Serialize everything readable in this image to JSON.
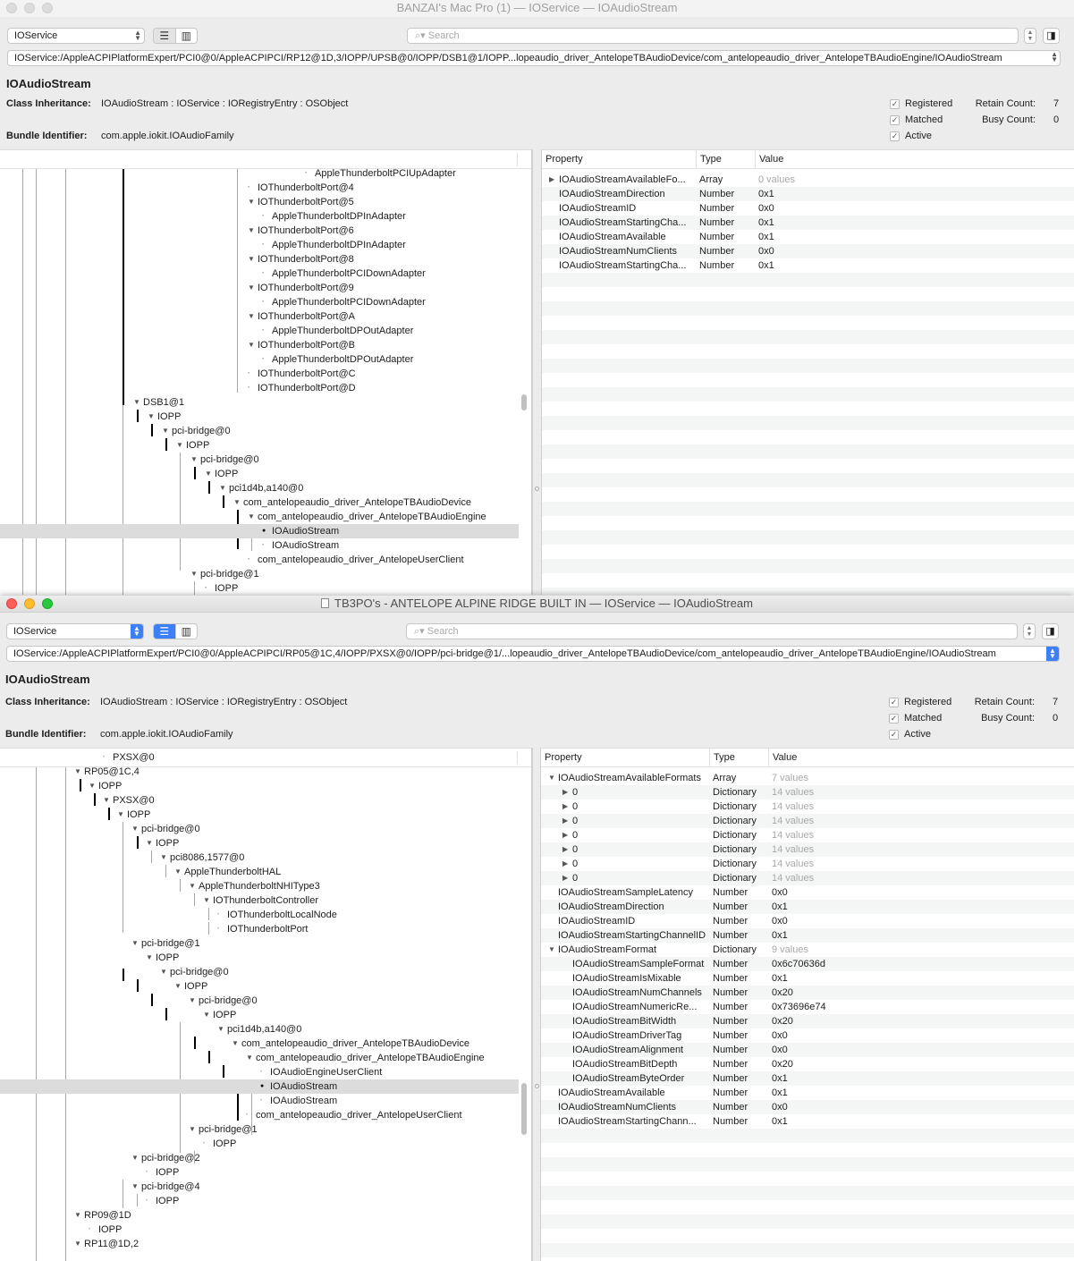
{
  "win1": {
    "title": "BANZAI's Mac Pro (1) — IOService — IOAudioStream",
    "plane": "IOService",
    "search_placeholder": "Search",
    "path": "IOService:/AppleACPIPlatformExpert/PCI0@0/AppleACPIPCI/RP12@1D,3/IOPP/UPSB@0/IOPP/DSB1@1/IOPP...lopeaudio_driver_AntelopeTBAudioDevice/com_antelopeaudio_driver_AntelopeTBAudioEngine/IOAudioStream",
    "object_name": "IOAudioStream",
    "class_inheritance_label": "Class Inheritance:",
    "class_inheritance": "IOAudioStream : IOService : IORegistryEntry : OSObject",
    "bundle_label": "Bundle Identifier:",
    "bundle_id": "com.apple.iokit.IOAudioFamily",
    "registered": "Registered",
    "matched": "Matched",
    "active": "Active",
    "retain_label": "Retain Count:",
    "retain": "7",
    "busy_label": "Busy Count:",
    "busy": "0",
    "tree": [
      {
        "label": "AppleThunderboltPCIUpAdapter"
      },
      {
        "label": "IOThunderboltPort@4"
      },
      {
        "label": "IOThunderboltPort@5"
      },
      {
        "label": "AppleThunderboltDPInAdapter"
      },
      {
        "label": "IOThunderboltPort@6"
      },
      {
        "label": "AppleThunderboltDPInAdapter"
      },
      {
        "label": "IOThunderboltPort@8"
      },
      {
        "label": "AppleThunderboltPCIDownAdapter"
      },
      {
        "label": "IOThunderboltPort@9"
      },
      {
        "label": "AppleThunderboltPCIDownAdapter"
      },
      {
        "label": "IOThunderboltPort@A"
      },
      {
        "label": "AppleThunderboltDPOutAdapter"
      },
      {
        "label": "IOThunderboltPort@B"
      },
      {
        "label": "AppleThunderboltDPOutAdapter"
      },
      {
        "label": "IOThunderboltPort@C"
      },
      {
        "label": "IOThunderboltPort@D"
      },
      {
        "label": "DSB1@1"
      },
      {
        "label": "IOPP"
      },
      {
        "label": "pci-bridge@0"
      },
      {
        "label": "IOPP"
      },
      {
        "label": "pci-bridge@0"
      },
      {
        "label": "IOPP"
      },
      {
        "label": "pci1d4b,a140@0"
      },
      {
        "label": "com_antelopeaudio_driver_AntelopeTBAudioDevice"
      },
      {
        "label": "com_antelopeaudio_driver_AntelopeTBAudioEngine"
      },
      {
        "label": "IOAudioStream"
      },
      {
        "label": "IOAudioStream"
      },
      {
        "label": "com_antelopeaudio_driver_AntelopeUserClient"
      },
      {
        "label": "pci-bridge@1"
      },
      {
        "label": "IOPP"
      }
    ],
    "prop_headers": {
      "property": "Property",
      "type": "Type",
      "value": "Value"
    },
    "props": [
      {
        "name": "IOAudioStreamAvailableFo...",
        "type": "Array",
        "value": "0 values"
      },
      {
        "name": "IOAudioStreamDirection",
        "type": "Number",
        "value": "0x1"
      },
      {
        "name": "IOAudioStreamID",
        "type": "Number",
        "value": "0x0"
      },
      {
        "name": "IOAudioStreamStartingCha...",
        "type": "Number",
        "value": "0x1"
      },
      {
        "name": "IOAudioStreamAvailable",
        "type": "Number",
        "value": "0x1"
      },
      {
        "name": "IOAudioStreamNumClients",
        "type": "Number",
        "value": "0x0"
      },
      {
        "name": "IOAudioStreamStartingCha...",
        "type": "Number",
        "value": "0x1"
      }
    ]
  },
  "win2": {
    "title": "TB3PO's - ANTELOPE ALPINE RIDGE BUILT IN — IOService — IOAudioStream",
    "plane": "IOService",
    "search_placeholder": "Search",
    "path": "IOService:/AppleACPIPlatformExpert/PCI0@0/AppleACPIPCI/RP05@1C,4/IOPP/PXSX@0/IOPP/pci-bridge@1/...lopeaudio_driver_AntelopeTBAudioDevice/com_antelopeaudio_driver_AntelopeTBAudioEngine/IOAudioStream",
    "object_name": "IOAudioStream",
    "class_inheritance_label": "Class Inheritance:",
    "class_inheritance": "IOAudioStream : IOService : IORegistryEntry : OSObject",
    "bundle_label": "Bundle Identifier:",
    "bundle_id": "com.apple.iokit.IOAudioFamily",
    "registered": "Registered",
    "matched": "Matched",
    "active": "Active",
    "retain_label": "Retain Count:",
    "retain": "7",
    "busy_label": "Busy Count:",
    "busy": "0",
    "tree": [
      {
        "label": "IOPP"
      },
      {
        "label": "PXSX@0"
      },
      {
        "label": "RP05@1C,4"
      },
      {
        "label": "IOPP"
      },
      {
        "label": "PXSX@0"
      },
      {
        "label": "IOPP"
      },
      {
        "label": "pci-bridge@0"
      },
      {
        "label": "IOPP"
      },
      {
        "label": "pci8086,1577@0"
      },
      {
        "label": "AppleThunderboltHAL"
      },
      {
        "label": "AppleThunderboltNHIType3"
      },
      {
        "label": "IOThunderboltController"
      },
      {
        "label": "IOThunderboltLocalNode"
      },
      {
        "label": "IOThunderboltPort"
      },
      {
        "label": "pci-bridge@1"
      },
      {
        "label": "IOPP"
      },
      {
        "label": "pci-bridge@0"
      },
      {
        "label": "IOPP"
      },
      {
        "label": "pci-bridge@0"
      },
      {
        "label": "IOPP"
      },
      {
        "label": "pci1d4b,a140@0"
      },
      {
        "label": "com_antelopeaudio_driver_AntelopeTBAudioDevice"
      },
      {
        "label": "com_antelopeaudio_driver_AntelopeTBAudioEngine"
      },
      {
        "label": "IOAudioEngineUserClient"
      },
      {
        "label": "IOAudioStream"
      },
      {
        "label": "IOAudioStream"
      },
      {
        "label": "com_antelopeaudio_driver_AntelopeUserClient"
      },
      {
        "label": "pci-bridge@1"
      },
      {
        "label": "IOPP"
      },
      {
        "label": "pci-bridge@2"
      },
      {
        "label": "IOPP"
      },
      {
        "label": "pci-bridge@4"
      },
      {
        "label": "IOPP"
      },
      {
        "label": "RP09@1D"
      },
      {
        "label": "IOPP"
      },
      {
        "label": "RP11@1D,2"
      }
    ],
    "prop_headers": {
      "property": "Property",
      "type": "Type",
      "value": "Value"
    },
    "props": [
      {
        "name": "IOAudioStreamAvailableFormats",
        "type": "Array",
        "value": "7 values"
      },
      {
        "name": "0",
        "type": "Dictionary",
        "value": "14 values"
      },
      {
        "name": "0",
        "type": "Dictionary",
        "value": "14 values"
      },
      {
        "name": "0",
        "type": "Dictionary",
        "value": "14 values"
      },
      {
        "name": "0",
        "type": "Dictionary",
        "value": "14 values"
      },
      {
        "name": "0",
        "type": "Dictionary",
        "value": "14 values"
      },
      {
        "name": "0",
        "type": "Dictionary",
        "value": "14 values"
      },
      {
        "name": "0",
        "type": "Dictionary",
        "value": "14 values"
      },
      {
        "name": "IOAudioStreamSampleLatency",
        "type": "Number",
        "value": "0x0"
      },
      {
        "name": "IOAudioStreamDirection",
        "type": "Number",
        "value": "0x1"
      },
      {
        "name": "IOAudioStreamID",
        "type": "Number",
        "value": "0x0"
      },
      {
        "name": "IOAudioStreamStartingChannelID",
        "type": "Number",
        "value": "0x1"
      },
      {
        "name": "IOAudioStreamFormat",
        "type": "Dictionary",
        "value": "9 values"
      },
      {
        "name": "IOAudioStreamSampleFormat",
        "type": "Number",
        "value": "0x6c70636d"
      },
      {
        "name": "IOAudioStreamIsMixable",
        "type": "Number",
        "value": "0x1"
      },
      {
        "name": "IOAudioStreamNumChannels",
        "type": "Number",
        "value": "0x20"
      },
      {
        "name": "IOAudioStreamNumericRe...",
        "type": "Number",
        "value": "0x73696e74"
      },
      {
        "name": "IOAudioStreamBitWidth",
        "type": "Number",
        "value": "0x20"
      },
      {
        "name": "IOAudioStreamDriverTag",
        "type": "Number",
        "value": "0x0"
      },
      {
        "name": "IOAudioStreamAlignment",
        "type": "Number",
        "value": "0x0"
      },
      {
        "name": "IOAudioStreamBitDepth",
        "type": "Number",
        "value": "0x20"
      },
      {
        "name": "IOAudioStreamByteOrder",
        "type": "Number",
        "value": "0x1"
      },
      {
        "name": "IOAudioStreamAvailable",
        "type": "Number",
        "value": "0x1"
      },
      {
        "name": "IOAudioStreamNumClients",
        "type": "Number",
        "value": "0x0"
      },
      {
        "name": "IOAudioStreamStartingChann...",
        "type": "Number",
        "value": "0x1"
      }
    ]
  },
  "colors": {
    "accent": "#3d7ff5",
    "selection": "#dcdcdc",
    "close": "#fd5e57",
    "minimize": "#febc2e",
    "zoom": "#28c840"
  },
  "icons": {
    "list_view": "list-view-icon",
    "column_view": "column-view-icon",
    "inspector": "inspector-icon",
    "search": "search-icon"
  }
}
